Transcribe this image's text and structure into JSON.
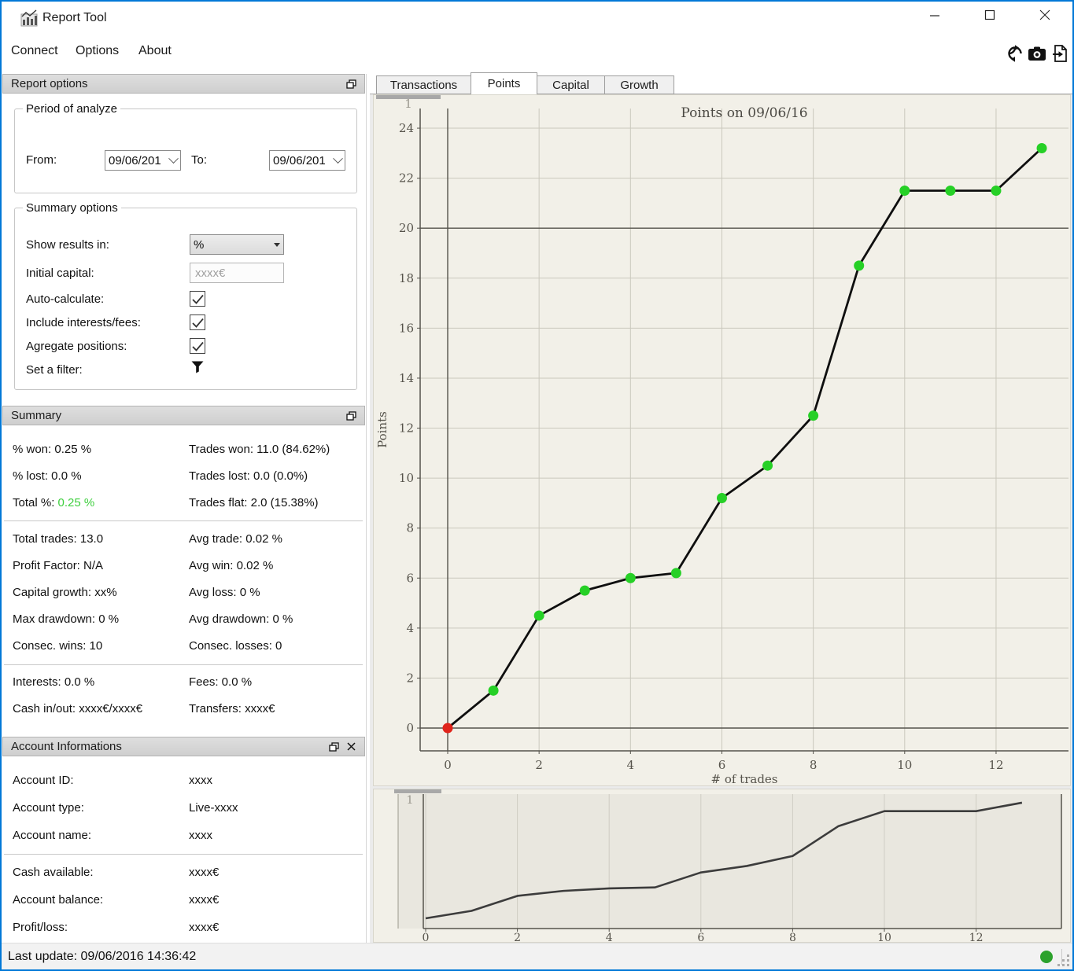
{
  "window": {
    "title": "Report Tool"
  },
  "menu": {
    "items": [
      "Connect",
      "Options",
      "About"
    ]
  },
  "toolbar": {
    "icons": [
      "refresh-icon",
      "camera-icon",
      "export-icon"
    ]
  },
  "report_options": {
    "header": "Report options",
    "period_group": {
      "legend": "Period of analyze",
      "from_label": "From:",
      "from_value": "09/06/201",
      "to_label": "To:",
      "to_value": "09/06/201"
    },
    "summary_group": {
      "legend": "Summary options",
      "show_results_label": "Show results in:",
      "show_results_value": "%",
      "initial_capital_label": "Initial capital:",
      "initial_capital_placeholder": "xxxx€",
      "auto_calculate_label": "Auto-calculate:",
      "auto_calculate_checked": true,
      "include_interests_label": "Include interests/fees:",
      "include_interests_checked": true,
      "aggregate_label": "Agregate positions:",
      "aggregate_checked": true,
      "filter_label": "Set a filter:"
    }
  },
  "summary": {
    "header": "Summary",
    "pct_won": "% won: 0.25 %",
    "trades_won": "Trades won: 11.0 (84.62%)",
    "pct_lost": "% lost: 0.0 %",
    "trades_lost": "Trades lost: 0.0 (0.0%)",
    "total_label": "Total %:",
    "total_value": "0.25 %",
    "total_value_color": "#3ecf3e",
    "trades_flat": "Trades flat: 2.0 (15.38%)",
    "total_trades": "Total trades: 13.0",
    "avg_trade": "Avg trade: 0.02 %",
    "profit_factor": "Profit Factor: N/A",
    "avg_win": "Avg win: 0.02 %",
    "capital_growth": "Capital growth: xx%",
    "avg_loss": "Avg loss: 0 %",
    "max_drawdown": "Max drawdown: 0 %",
    "avg_drawdown": "Avg drawdown: 0 %",
    "consec_wins": "Consec. wins: 10",
    "consec_losses": "Consec. losses: 0",
    "interests": "Interests: 0.0 %",
    "fees": "Fees: 0.0 %",
    "cash_in_out": "Cash in/out: xxxx€/xxxx€",
    "transfers": "Transfers: xxxx€"
  },
  "account": {
    "header": "Account Informations",
    "rows": [
      {
        "label": "Account ID:",
        "value": "xxxx"
      },
      {
        "label": "Account type:",
        "value": "Live-xxxx"
      },
      {
        "label": "Account name:",
        "value": "xxxx"
      },
      {
        "label": "Cash available:",
        "value": "xxxx€"
      },
      {
        "label": "Account balance:",
        "value": "xxxx€"
      },
      {
        "label": "Profit/loss:",
        "value": "xxxx€"
      }
    ]
  },
  "tabs": {
    "items": [
      "Transactions",
      "Points",
      "Capital",
      "Growth"
    ],
    "active": "Points"
  },
  "statusbar": {
    "last_update": "Last update: 09/06/2016 14:36:42",
    "status_dot_color": "#2ca22c"
  },
  "chart_data": [
    {
      "type": "line",
      "title": "Points on 09/06/16",
      "xlabel": "# of trades",
      "ylabel": "Points",
      "x": [
        0,
        1,
        2,
        3,
        4,
        5,
        6,
        7,
        8,
        9,
        10,
        11,
        12,
        13
      ],
      "values": [
        0,
        1.5,
        4.5,
        5.5,
        6.0,
        6.2,
        9.2,
        10.5,
        12.5,
        18.5,
        21.5,
        21.5,
        21.5,
        23.2
      ],
      "xticks": [
        0,
        2,
        4,
        6,
        8,
        10,
        12
      ],
      "yticks": [
        0,
        2,
        4,
        6,
        8,
        10,
        12,
        14,
        16,
        18,
        20,
        22,
        24
      ],
      "xlim": [
        -0.6,
        13.6
      ],
      "ylim": [
        -0.9,
        24.8
      ],
      "grid": true,
      "legend": "none",
      "markers": true,
      "line_color": "#0f0f0f",
      "marker_color": "#26d026",
      "first_marker_color": "#e0241b",
      "grid_color": "#cac8bd",
      "axis_color": "#55534c",
      "dark_xlines": [
        0
      ],
      "dark_ylines": [
        0,
        20
      ],
      "corner_labels": [
        "0",
        "1"
      ]
    },
    {
      "type": "line",
      "title": "",
      "xlabel": "",
      "ylabel": "",
      "x": [
        0,
        1,
        2,
        3,
        4,
        5,
        6,
        7,
        8,
        9,
        10,
        11,
        12,
        13
      ],
      "values": [
        0,
        1.5,
        4.5,
        5.5,
        6.0,
        6.2,
        9.2,
        10.5,
        12.5,
        18.5,
        21.5,
        21.5,
        21.5,
        23.2
      ],
      "xticks": [
        0,
        2,
        4,
        6,
        8,
        10,
        12
      ],
      "yticks": [],
      "xlim": [
        -1.1,
        13.9
      ],
      "ylim": [
        -2.1,
        25.8
      ],
      "grid": true,
      "legend": "none",
      "markers": false,
      "line_color": "#3c3c3c",
      "grid_color": "#cfcdc4",
      "axis_color": "#55534c",
      "corner_labels": [
        "0",
        "1"
      ]
    }
  ]
}
